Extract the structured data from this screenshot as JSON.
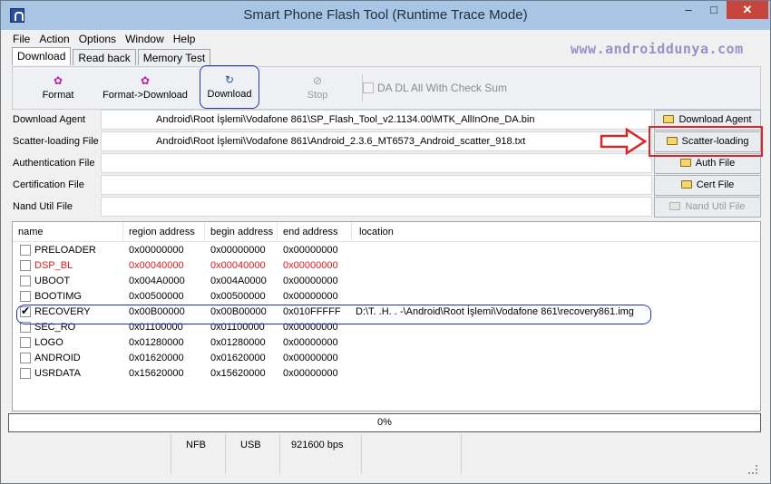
{
  "window": {
    "title": "Smart Phone Flash Tool (Runtime Trace Mode)",
    "controls": {
      "minimize": "–",
      "maximize": "□",
      "close": "✕"
    }
  },
  "watermark": "www.androiddunya.com",
  "menu": [
    "File",
    "Action",
    "Options",
    "Window",
    "Help"
  ],
  "tabs": [
    "Download",
    "Read back",
    "Memory Test"
  ],
  "toolbar": {
    "format": "Format",
    "format_download": "Format->Download",
    "download": "Download",
    "stop": "Stop",
    "checksum": "DA DL All With Check Sum"
  },
  "files": {
    "download_agent": {
      "label": "Download Agent",
      "value": "Android\\Root İşlemi\\Vodafone 861\\SP_Flash_Tool_v2.1134.00\\MTK_AllInOne_DA.bin",
      "button": "Download Agent"
    },
    "scatter": {
      "label": "Scatter-loading File",
      "value": "Android\\Root İşlemi\\Vodafone 861\\Android_2.3.6_MT6573_Android_scatter_918.txt",
      "button": "Scatter-loading"
    },
    "auth": {
      "label": "Authentication File",
      "value": "",
      "button": "Auth File"
    },
    "cert": {
      "label": "Certification File",
      "value": "",
      "button": "Cert File"
    },
    "nand": {
      "label": "Nand Util File",
      "value": "",
      "button": "Nand Util File"
    }
  },
  "partition_table": {
    "headers": [
      "name",
      "region address",
      "begin address",
      "end address",
      "location"
    ],
    "rows": [
      {
        "name": "PRELOADER",
        "region": "0x00000000",
        "begin": "0x00000000",
        "end": "0x00000000",
        "location": "",
        "checked": false,
        "red": false
      },
      {
        "name": "DSP_BL",
        "region": "0x00040000",
        "begin": "0x00040000",
        "end": "0x00000000",
        "location": "",
        "checked": false,
        "red": true
      },
      {
        "name": "UBOOT",
        "region": "0x004A0000",
        "begin": "0x004A0000",
        "end": "0x00000000",
        "location": "",
        "checked": false,
        "red": false
      },
      {
        "name": "BOOTIMG",
        "region": "0x00500000",
        "begin": "0x00500000",
        "end": "0x00000000",
        "location": "",
        "checked": false,
        "red": false
      },
      {
        "name": "RECOVERY",
        "region": "0x00B00000",
        "begin": "0x00B00000",
        "end": "0x010FFFFF",
        "location": "D:\\T. .H. . -\\Android\\Root İşlemi\\Vodafone 861\\recovery861.img",
        "checked": true,
        "red": false
      },
      {
        "name": "SEC_RO",
        "region": "0x01100000",
        "begin": "0x01100000",
        "end": "0x00000000",
        "location": "",
        "checked": false,
        "red": false
      },
      {
        "name": "LOGO",
        "region": "0x01280000",
        "begin": "0x01280000",
        "end": "0x00000000",
        "location": "",
        "checked": false,
        "red": false
      },
      {
        "name": "ANDROID",
        "region": "0x01620000",
        "begin": "0x01620000",
        "end": "0x00000000",
        "location": "",
        "checked": false,
        "red": false
      },
      {
        "name": "USRDATA",
        "region": "0x15620000",
        "begin": "0x15620000",
        "end": "0x00000000",
        "location": "",
        "checked": false,
        "red": false
      }
    ]
  },
  "progress": {
    "text": "0%",
    "value": 0
  },
  "status": {
    "type": "NFB",
    "port": "USB",
    "baud": "921600 bps"
  },
  "colors": {
    "highlight": "#d6282b",
    "outline": "#2030b0",
    "red_row": "#e0191c",
    "titlebar": "#a8c6e4"
  }
}
